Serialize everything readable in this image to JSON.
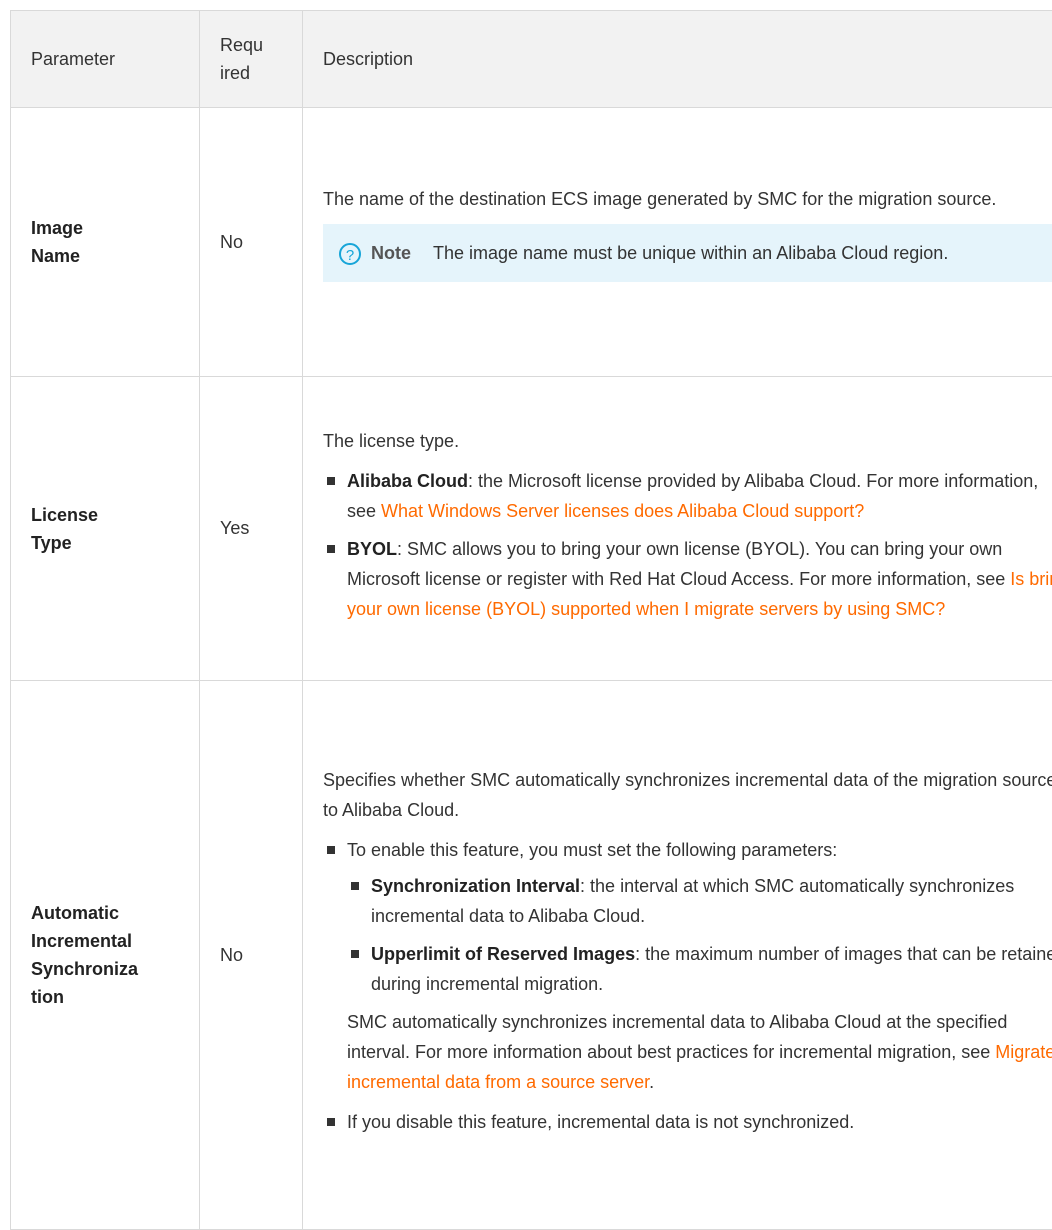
{
  "header": {
    "parameter": "Parameter",
    "required": "Requ ired",
    "description": "Description"
  },
  "rows": [
    {
      "param": "Image Name",
      "required": "No",
      "desc_intro": "The name of the destination ECS image generated by SMC for the migration source.",
      "note_label": "Note",
      "note_text": "The image name must be unique within an Alibaba Cloud region."
    },
    {
      "param": "License Type",
      "required": "Yes",
      "desc_intro": "The license type.",
      "items": [
        {
          "term": "Alibaba Cloud",
          "text": ": the Microsoft license provided by Alibaba Cloud. For more information, see ",
          "link": "What Windows Server licenses does Alibaba Cloud support?"
        },
        {
          "term": "BYOL",
          "text": ": SMC allows you to bring your own license (BYOL). You can bring your own Microsoft license or register with Red Hat Cloud Access. For more information, see ",
          "link": "Is bring your own license (BYOL) supported when I migrate servers by using SMC?"
        }
      ]
    },
    {
      "param": "Automatic Incremental Synchronization",
      "required": "No",
      "desc_intro": "Specifies whether SMC automatically synchronizes incremental data of the migration source to Alibaba Cloud.",
      "enable_text": "To enable this feature, you must set the following parameters:",
      "sub_items": [
        {
          "term": "Synchronization Interval",
          "text": ": the interval at which SMC automatically synchronizes incremental data to Alibaba Cloud."
        },
        {
          "term": "Upperlimit of Reserved Images",
          "text": ": the maximum number of images that can be retained during incremental migration."
        }
      ],
      "sync_text": "SMC automatically synchronizes incremental data to Alibaba Cloud at the specified interval. For more information about best practices for incremental migration, see ",
      "sync_link": "Migrate incremental data from a source server",
      "sync_end": ".",
      "disable_text": "If you disable this feature, incremental data is not synchronized."
    }
  ]
}
